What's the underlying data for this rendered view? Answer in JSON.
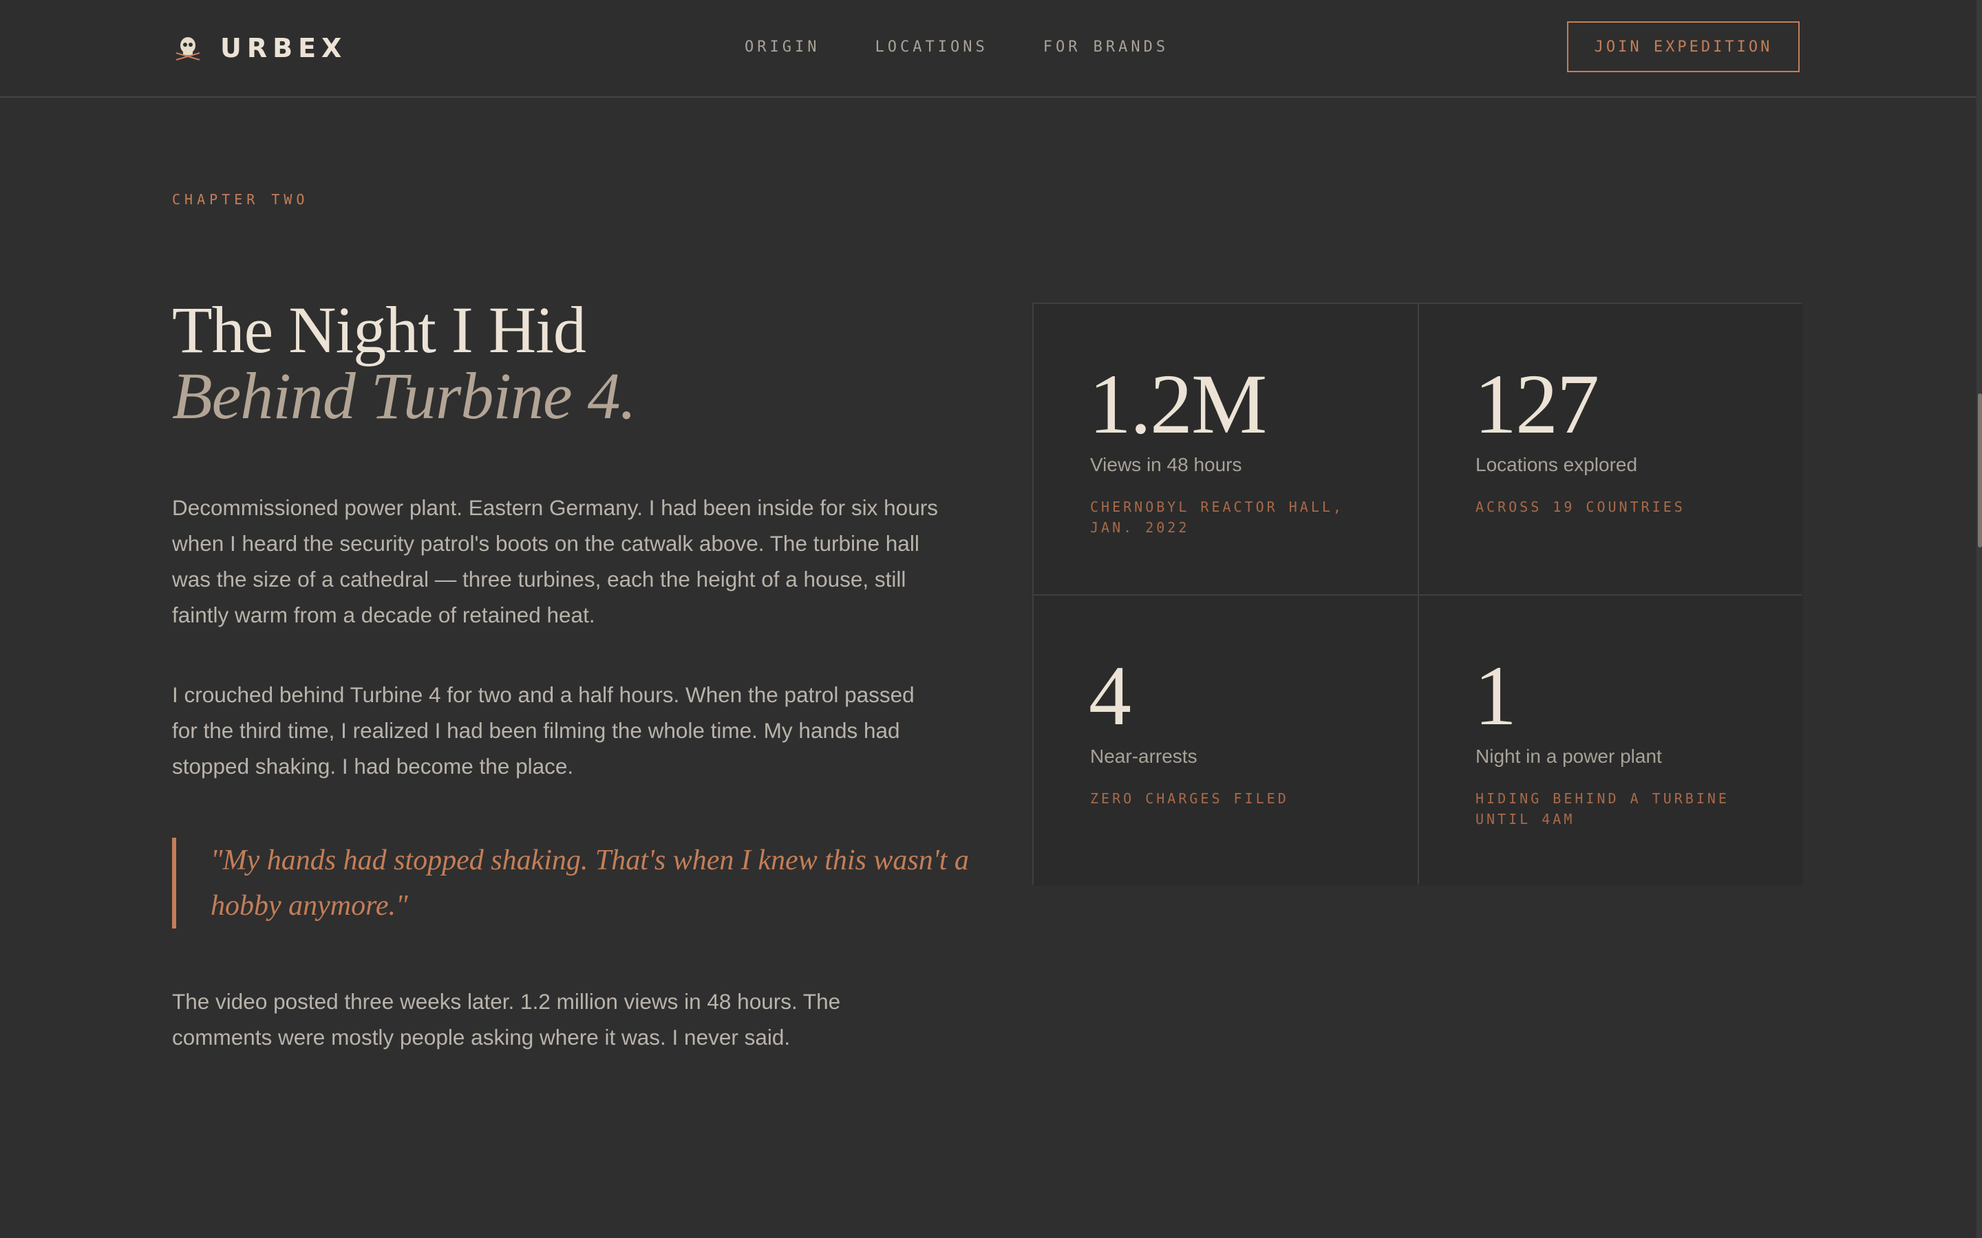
{
  "header": {
    "brand": "URBEX",
    "nav": [
      "ORIGIN",
      "LOCATIONS",
      "FOR BRANDS"
    ],
    "cta": "JOIN EXPEDITION"
  },
  "story": {
    "eyebrow": "CHAPTER TWO",
    "title_line1": "The Night I Hid",
    "title_line2": "Behind Turbine 4.",
    "paragraph1": "Decommissioned power plant. Eastern Germany. I had been inside for six hours when I heard the security patrol's boots on the catwalk above. The turbine hall was the size of a cathedral — three turbines, each the height of a house, still faintly warm from a decade of retained heat.",
    "paragraph2": "I crouched behind Turbine 4 for two and a half hours. When the patrol passed for the third time, I realized I had been filming the whole time. My hands had stopped shaking. I had become the place.",
    "quote": "\"My hands had stopped shaking. That's when I knew this wasn't a hobby anymore.\"",
    "paragraph3": "The video posted three weeks later. 1.2 million views in 48 hours. The comments were mostly people asking where it was. I never said."
  },
  "stats": [
    {
      "value": "1.2M",
      "label": "Views in 48 hours",
      "note": "CHERNOBYL REACTOR HALL, JAN. 2022"
    },
    {
      "value": "127",
      "label": "Locations explored",
      "note": "ACROSS 19 COUNTRIES"
    },
    {
      "value": "4",
      "label": "Near-arrests",
      "note": "ZERO CHARGES FILED"
    },
    {
      "value": "1",
      "label": "Night in a power plant",
      "note": "HIDING BEHIND A TURBINE UNTIL 4AM"
    }
  ],
  "colors": {
    "background": "#2f2f2f",
    "accent": "#c47e58",
    "text_primary": "#ece3d6",
    "text_muted": "#b9b3ab"
  },
  "icons": {
    "brand": "skull-icon"
  }
}
